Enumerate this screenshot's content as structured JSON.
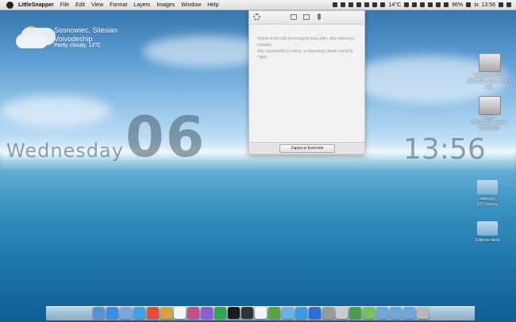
{
  "menubar": {
    "app_name": "LittleSnapper",
    "items": [
      "File",
      "Edit",
      "View",
      "Format",
      "Layers",
      "Images",
      "Window",
      "Help"
    ],
    "status": {
      "temperature": "14°C",
      "battery": "96%",
      "clock": "śr. 13:56"
    }
  },
  "weather": {
    "location": "Sosnowiec, Silesian\nVoivodeship",
    "condition": "Partly cloudy, 13°C"
  },
  "clock_widget": {
    "day": "Wednesday",
    "date": "06",
    "time": "13:56"
  },
  "note_panel": {
    "body_line1": "Wpisz treść lub przeciągnij tutaj pliki, aby utworzyć notatkę",
    "body_line2": "Aby wyświetlić to okno, w dowolnej chwili naciśnij ^⌘N",
    "save_button": "Zapisz w Evernote"
  },
  "desktop_icons": [
    {
      "label": "Macintosh SSD",
      "sub": "278,5 GB, wolne 198,6 GB"
    },
    {
      "label": "Dane",
      "sub": "475,91 GB, wolne 165,95 GB"
    },
    {
      "label": "roboczy",
      "sub": "377 rzeczy"
    },
    {
      "label": "Zdjęcia-skrót",
      "sub": ""
    }
  ],
  "dock": {
    "icons": [
      "finder-icon",
      "app-store-icon",
      "mail-icon",
      "safari-icon",
      "chrome-icon",
      "box-icon",
      "calendar-icon",
      "photos-icon",
      "itunes-icon",
      "spotify-icon",
      "music-icon",
      "sonos-icon",
      "textedit-icon",
      "evernote-icon",
      "cloud-icon",
      "twitter-icon",
      "messages-icon",
      "screen-icon",
      "preview-icon",
      "stocks-icon",
      "app-icon",
      "folder-apps-icon",
      "folder-docs-icon",
      "folder-downloads-icon",
      "trash-icon"
    ],
    "colors": [
      "#5a8fd6",
      "#3c8be5",
      "#7aa8dd",
      "#3aa5e0",
      "#e84d3c",
      "#d9a13a",
      "#f4f4f4",
      "#c84b8a",
      "#8d5bd6",
      "#2aa84a",
      "#1a1a1a",
      "#333333",
      "#f4f4f4",
      "#5aa33b",
      "#6cb0e6",
      "#3a9be0",
      "#2d6ed1",
      "#999999",
      "#cccccc",
      "#4d9a4d",
      "#7bbf5b",
      "#6fa7d2",
      "#6fa7d2",
      "#6fa7d2",
      "#b8b8b8"
    ]
  }
}
